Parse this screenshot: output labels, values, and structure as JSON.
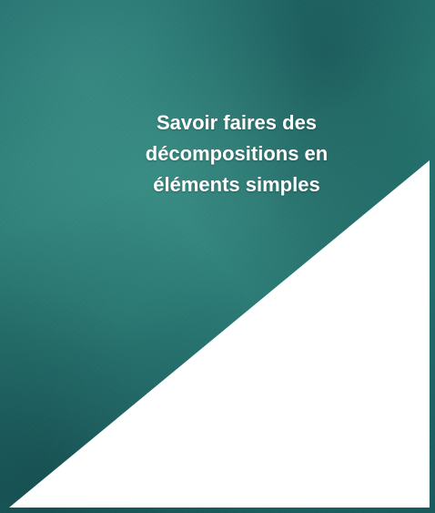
{
  "slide": {
    "title_lines": [
      "Savoir faires des",
      "décompositions en",
      "éléments simples"
    ]
  },
  "colors": {
    "background_teal": "#236f6c",
    "triangle": "#ffffff",
    "title_text": "#ffffff"
  }
}
